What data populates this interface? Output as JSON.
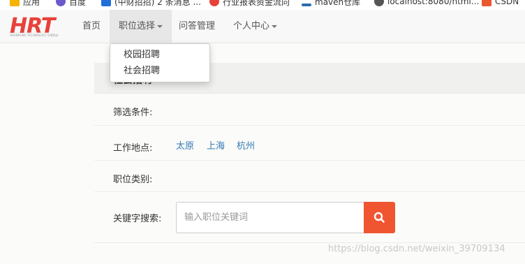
{
  "bookmarks": [
    {
      "label": "应用",
      "color": "#f4b400"
    },
    {
      "label": "百度",
      "color": "#6a5acd"
    },
    {
      "label": "(中财招招) 2 条消息 ...",
      "color": "#1e6fd9"
    },
    {
      "label": "行业报表资金流向",
      "color": "#e8413a"
    },
    {
      "label": "maven仓库",
      "color": "#2b6cb0"
    },
    {
      "label": "localhost:8080/html...",
      "color": "#555555"
    },
    {
      "label": "CSDN",
      "color": "#e8582c"
    }
  ],
  "logo": {
    "text": "HRT",
    "subtitle": "HUANRONG TECHNOLOGY 华荣科技"
  },
  "nav": {
    "home": "首页",
    "positions": "职位选择",
    "qa": "问答管理",
    "personal": "个人中心"
  },
  "dropdown": {
    "items": [
      "校园招聘",
      "社会招聘"
    ]
  },
  "panel": {
    "title": "社会招聘",
    "filter_label": "筛选条件:",
    "location_label": "工作地点:",
    "locations": [
      "太原",
      "上海",
      "杭州"
    ],
    "category_label": "职位类别:",
    "keyword_label": "关键字搜索:",
    "search_placeholder": "输入职位关键词"
  },
  "watermark": "https://blog.csdn.net/weixin_39709134",
  "colors": {
    "accent": "#f05532",
    "link": "#337ab7",
    "logo": "#e8413a"
  },
  "icons": {
    "search_button": "search-icon",
    "dropdown": "caret-down-icon"
  }
}
